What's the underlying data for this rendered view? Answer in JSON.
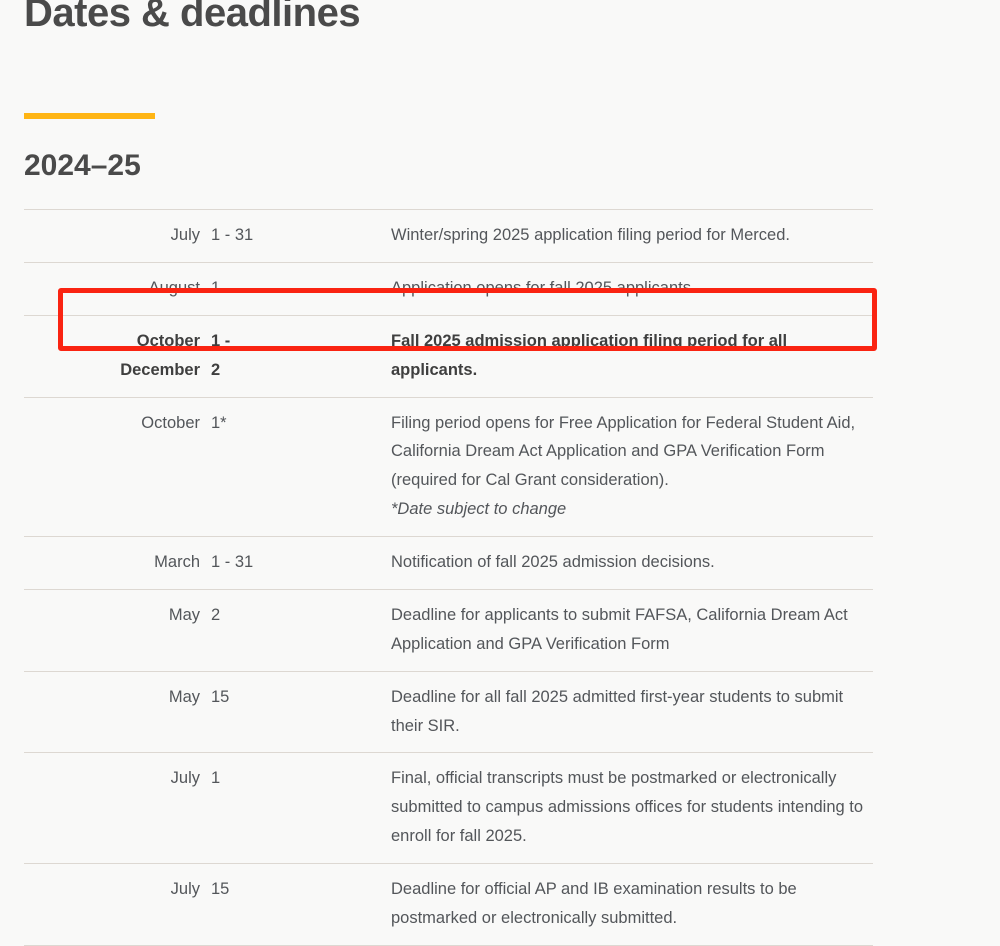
{
  "page": {
    "title": "Dates & deadlines",
    "year_heading": "2024–25",
    "accent_color": "#ffb514",
    "highlight_color": "#fa2412",
    "background_color": "#f9f9f8",
    "text_color": "#53565a"
  },
  "table": {
    "rows": [
      {
        "month": "July",
        "day": "1 - 31",
        "description": "Winter/spring 2025 application filing period for Merced.",
        "highlighted": false,
        "note": ""
      },
      {
        "month": "August",
        "day": "1",
        "description": "Application opens for fall 2025 applicants.",
        "highlighted": false,
        "note": ""
      },
      {
        "month": "October December",
        "day": "1 - 2",
        "description": "Fall 2025 admission application filing period for all applicants.",
        "highlighted": true,
        "note": ""
      },
      {
        "month": "October",
        "day": "1*",
        "description": "Filing period opens for Free Application for Federal Student Aid, California Dream Act Application and GPA Verification Form (required for Cal Grant consideration).",
        "highlighted": false,
        "note": "*Date subject to change"
      },
      {
        "month": "March",
        "day": "1 - 31",
        "description": "Notification of fall 2025 admission decisions.",
        "highlighted": false,
        "note": ""
      },
      {
        "month": "May",
        "day": "2",
        "description": "Deadline for applicants to submit FAFSA, California Dream Act Application and GPA Verification Form",
        "highlighted": false,
        "note": ""
      },
      {
        "month": "May",
        "day": "15",
        "description": "Deadline for all fall 2025 admitted first-year students to submit their SIR.",
        "highlighted": false,
        "note": ""
      },
      {
        "month": "July",
        "day": "1",
        "description": "Final, official transcripts must be postmarked or electronically submitted to campus admissions offices for students intending to enroll for fall 2025.",
        "highlighted": false,
        "note": ""
      },
      {
        "month": "July",
        "day": "15",
        "description": "Deadline for official AP and IB examination results to be postmarked or electronically submitted.",
        "highlighted": false,
        "note": ""
      }
    ]
  }
}
